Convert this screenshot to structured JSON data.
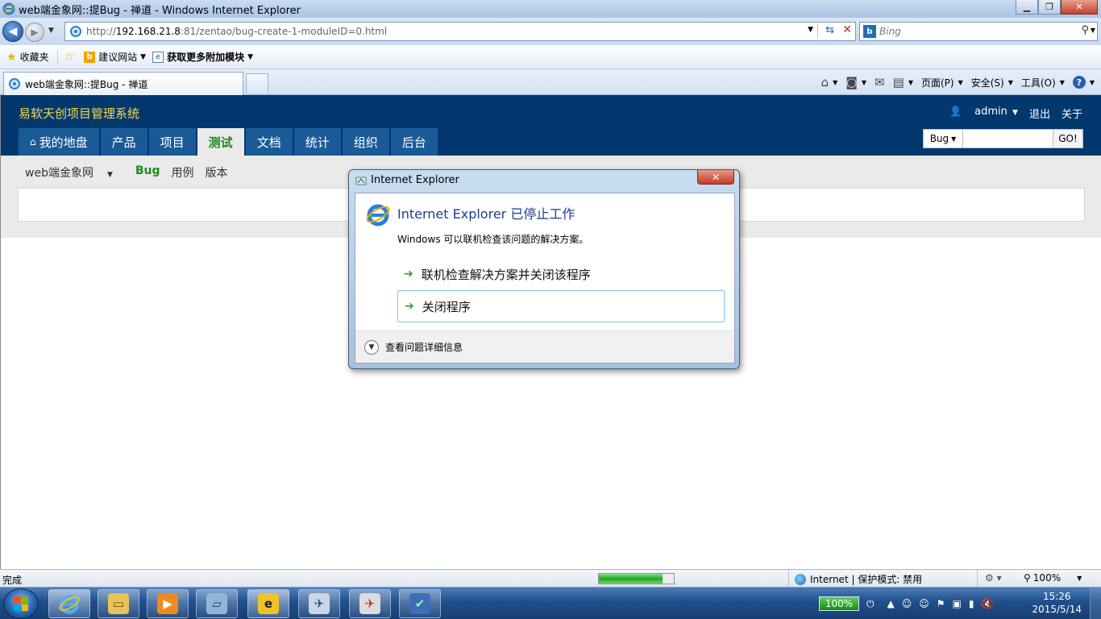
{
  "window": {
    "title": "web端金象网::提Bug - 禅道 - Windows Internet Explorer",
    "min_label": "▁",
    "max_label": "❐",
    "close_label": "✕"
  },
  "address": {
    "url_prefix": "http://",
    "url_host": "192.168.21.8",
    "url_rest": ":81/zentao/bug-create-1-moduleID=0.html"
  },
  "search": {
    "placeholder": "Bing"
  },
  "favorites": {
    "label": "收藏夹",
    "suggested_sites": "建议网站",
    "get_addons": "获取更多附加模块"
  },
  "tab": {
    "label": "web端金象网::提Bug - 禅道"
  },
  "commandbar": {
    "page": "页面(P)",
    "safety": "安全(S)",
    "tools": "工具(O)",
    "help": "?"
  },
  "zentao": {
    "brand": "易软天创项目管理系统",
    "user": "admin",
    "logout": "退出",
    "about": "关于",
    "nav": [
      "我的地盘",
      "产品",
      "项目",
      "测试",
      "文档",
      "统计",
      "组织",
      "后台"
    ],
    "active_nav": "测试",
    "search_type": "Bug",
    "search_go": "GO!",
    "sub_product": "web端金象网",
    "sub_nav": [
      "Bug",
      "用例",
      "版本"
    ]
  },
  "dialog": {
    "title": "Internet Explorer",
    "close_label": "✕",
    "heading": "Internet Explorer 已停止工作",
    "description": "Windows 可以联机检查该问题的解决方案。",
    "option1": "联机检查解决方案并关闭该程序",
    "option2": "关闭程序",
    "details": "查看问题详细信息"
  },
  "status": {
    "text": "完成",
    "progress": 0.85,
    "zone": "Internet | 保护模式: 禁用",
    "zoom": "100%"
  },
  "taskbar": {
    "battery": "100%",
    "time": "15:26",
    "date": "2015/5/14"
  },
  "colors": {
    "zentao_header": "#03386e",
    "zentao_brand": "#f7d84a",
    "active_green": "#1b8d1b"
  }
}
